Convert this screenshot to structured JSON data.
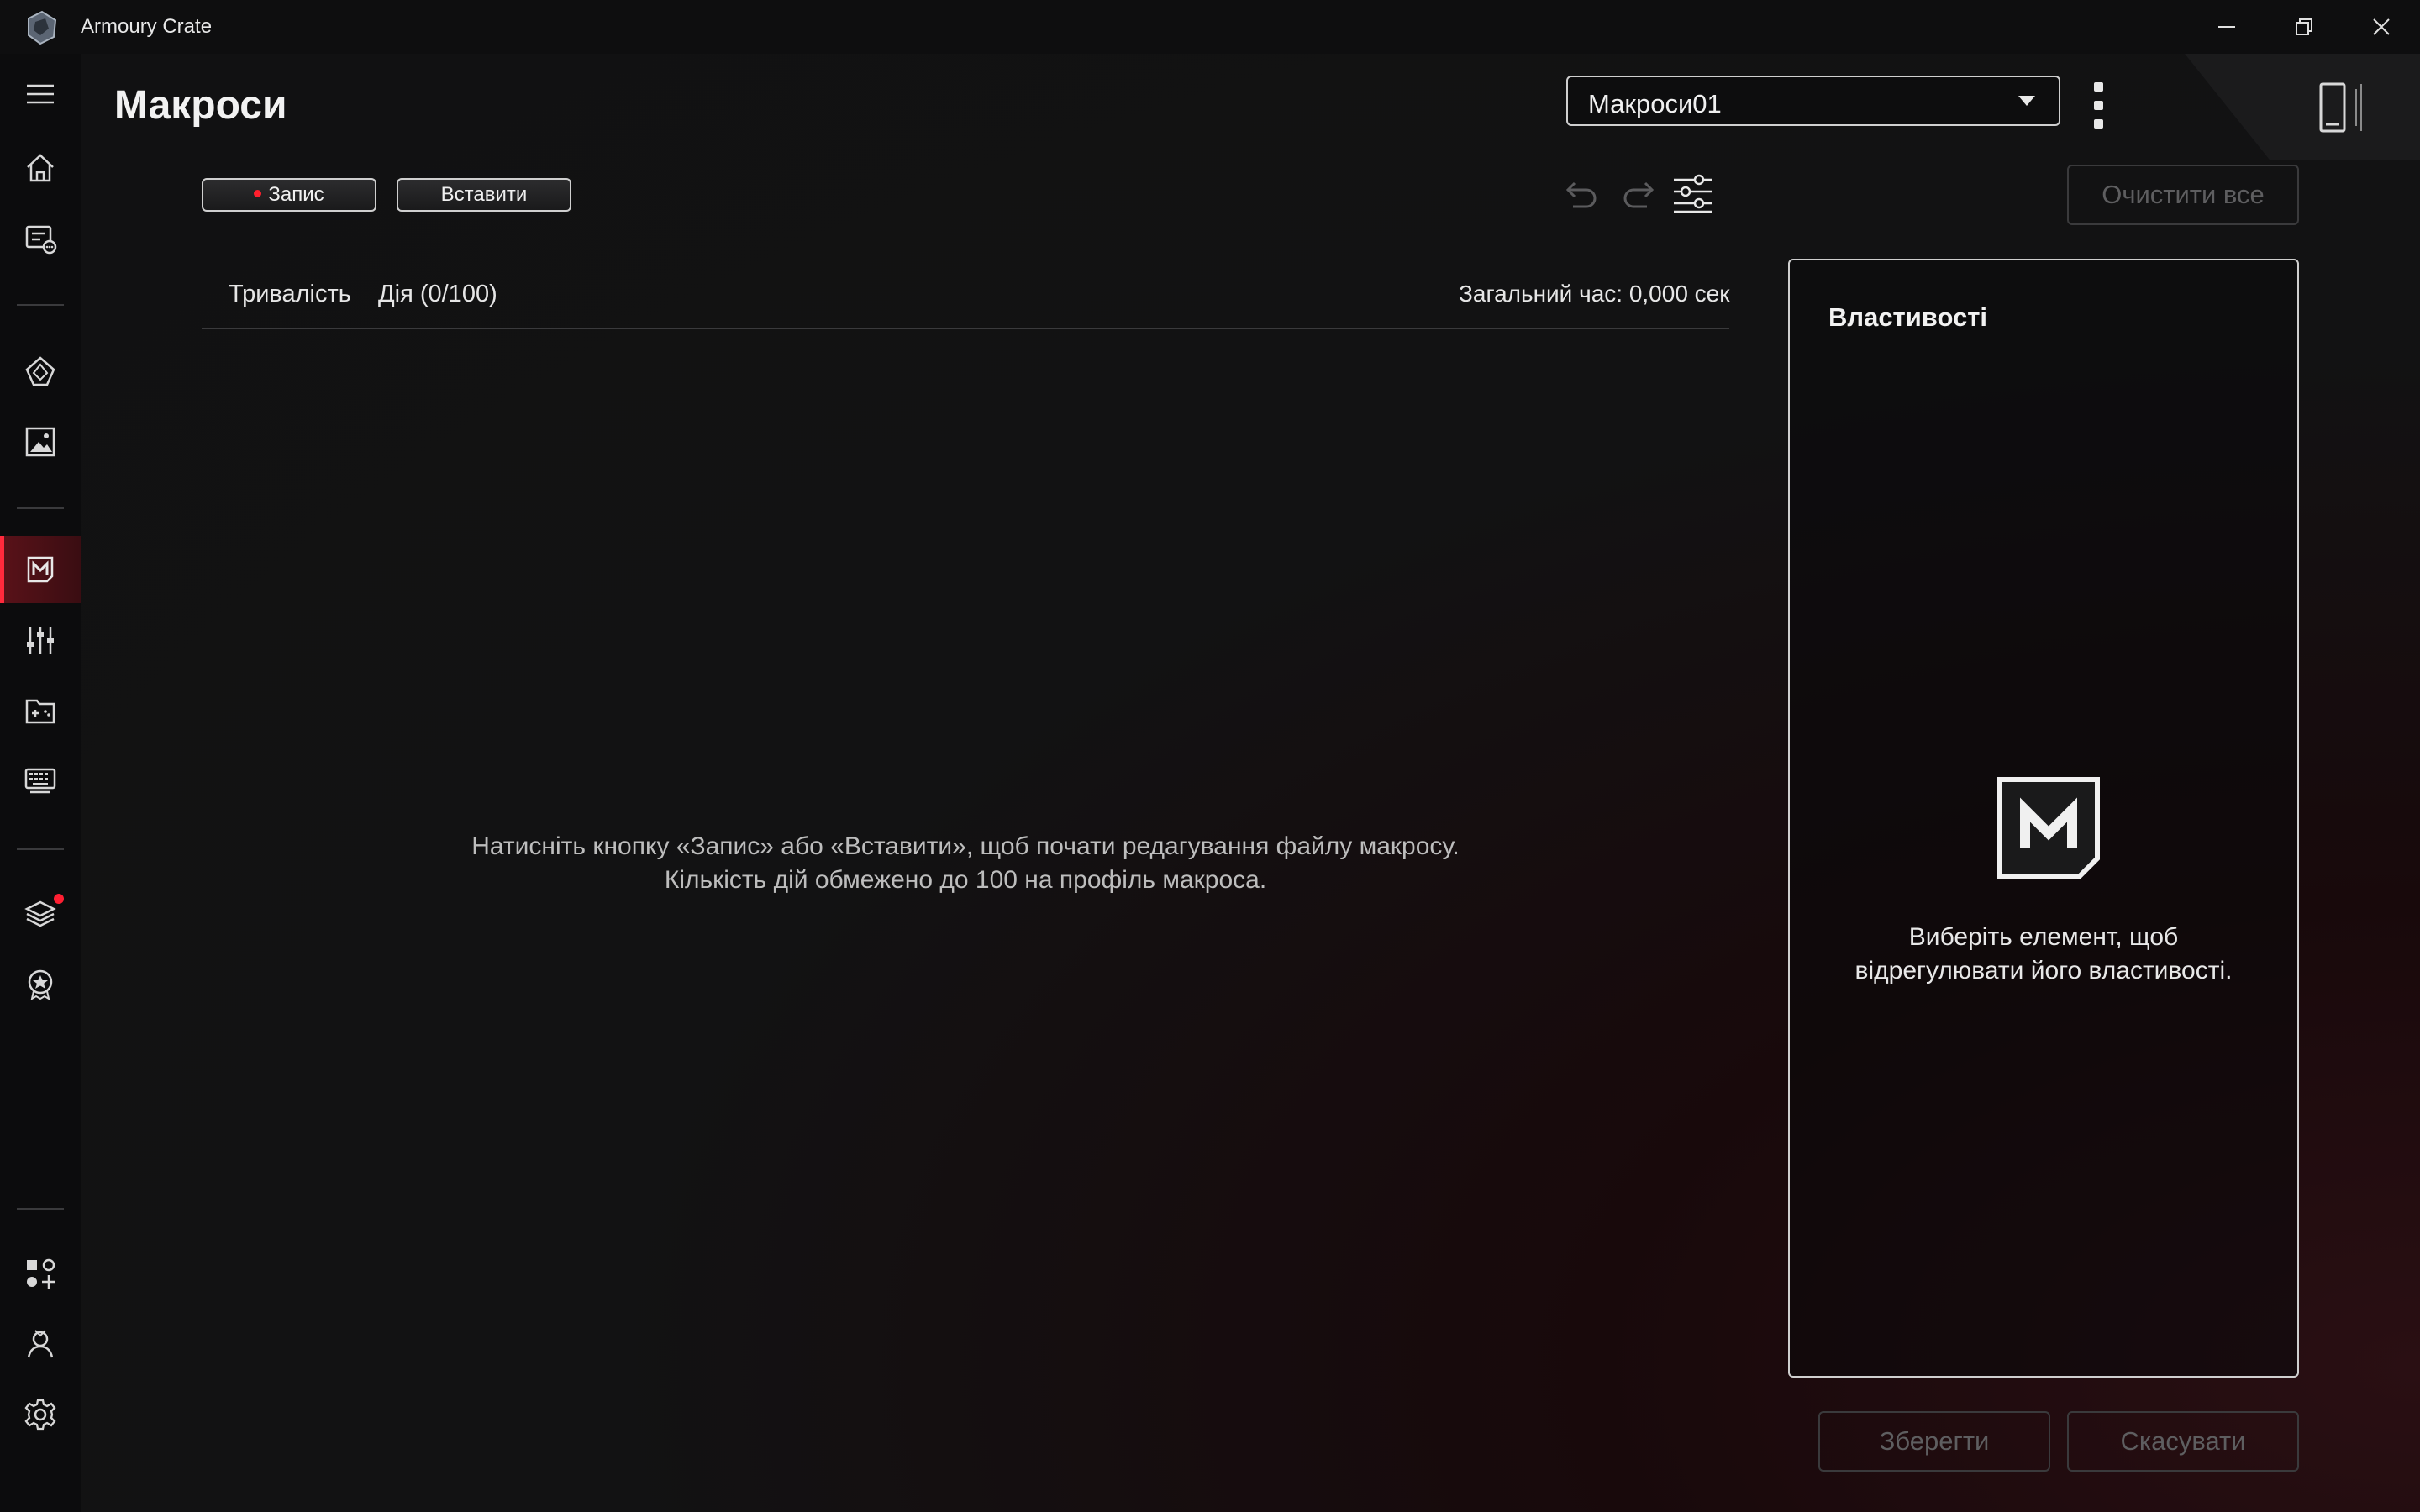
{
  "window": {
    "title": "Armoury Crate"
  },
  "sidebar": {
    "items": [
      {
        "name": "menu-icon"
      },
      {
        "name": "home-icon"
      },
      {
        "name": "device-icon"
      },
      {
        "name": "aura-icon"
      },
      {
        "name": "wallpaper-icon"
      },
      {
        "name": "macros-icon",
        "active": true
      },
      {
        "name": "audio-mixer-icon"
      },
      {
        "name": "game-library-icon"
      },
      {
        "name": "keyboard-icon"
      },
      {
        "name": "featured-layers-icon",
        "notification": true
      },
      {
        "name": "rewards-icon"
      },
      {
        "name": "add-widgets-icon"
      },
      {
        "name": "user-center-icon"
      },
      {
        "name": "settings-icon"
      }
    ],
    "accent_color": "#ff2a3c"
  },
  "header": {
    "page_title": "Макроси",
    "profile_select_value": "Макроси01"
  },
  "toolbar": {
    "record_label": "Запис",
    "insert_label": "Вставити",
    "clear_all_label": "Очистити все"
  },
  "list": {
    "col_duration": "Тривалість",
    "col_action": "Дія (0/100)",
    "total_time": "Загальний час:  0,000 сек",
    "empty_line1": "Натисніть кнопку «Запис» або «Вставити», щоб почати редагування файлу макросу.",
    "empty_line2": "Кількість дій обмежено до 100 на профіль макроса."
  },
  "properties": {
    "title": "Властивості",
    "hint_line1": "Виберіть елемент, щоб",
    "hint_line2": "відрегулювати його властивості."
  },
  "footer": {
    "save_label": "Зберегти",
    "cancel_label": "Скасувати"
  }
}
